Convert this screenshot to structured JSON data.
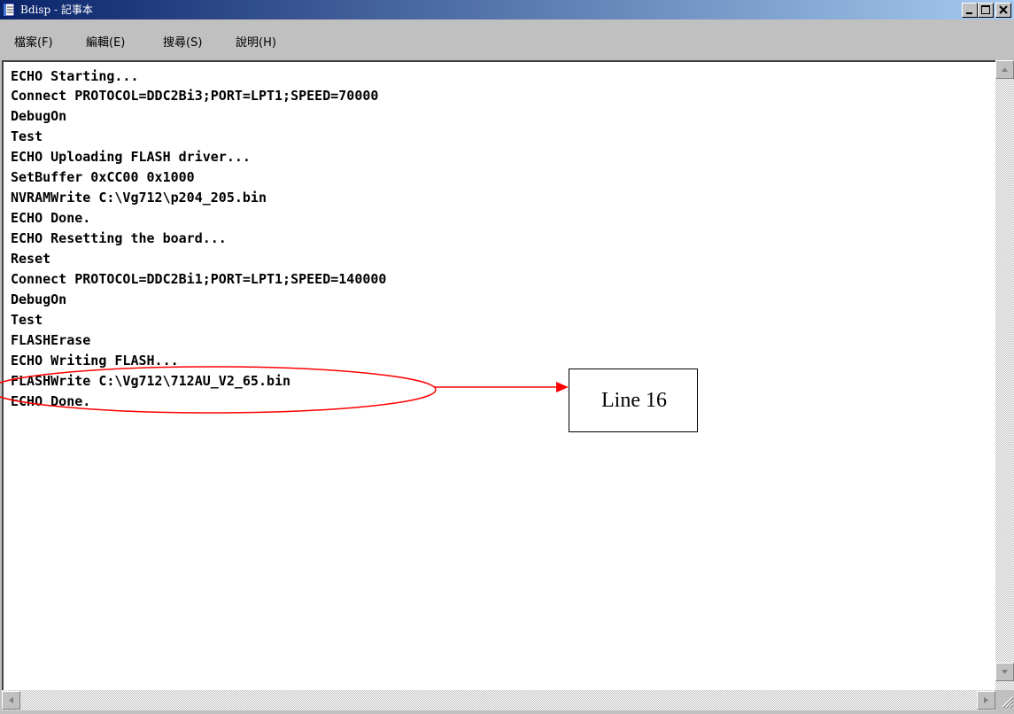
{
  "window": {
    "title": "Bdisp - 記事本",
    "icons": {
      "app": "notepad-icon",
      "minimize": "minimize-icon",
      "maximize": "maximize-icon",
      "close": "close-icon"
    }
  },
  "menu": [
    "檔案(F)",
    "編輯(E)",
    "搜尋(S)",
    "說明(H)"
  ],
  "editor": {
    "lines": [
      "ECHO Starting...",
      "Connect PROTOCOL=DDC2Bi3;PORT=LPT1;SPEED=70000",
      "DebugOn",
      "Test",
      "ECHO Uploading FLASH driver...",
      "SetBuffer 0xCC00 0x1000",
      "NVRAMWrite C:\\Vg712\\p204_205.bin",
      "ECHO Done.",
      "ECHO Resetting the board...",
      "Reset",
      "Connect PROTOCOL=DDC2Bi1;PORT=LPT1;SPEED=140000",
      "DebugOn",
      "Test",
      "FLASHErase",
      "ECHO Writing FLASH...",
      "FLASHWrite C:\\Vg712\\712AU_V2_65.bin",
      "ECHO Done."
    ]
  },
  "annotation": {
    "label": "Line 16",
    "color": "#ff0000"
  }
}
